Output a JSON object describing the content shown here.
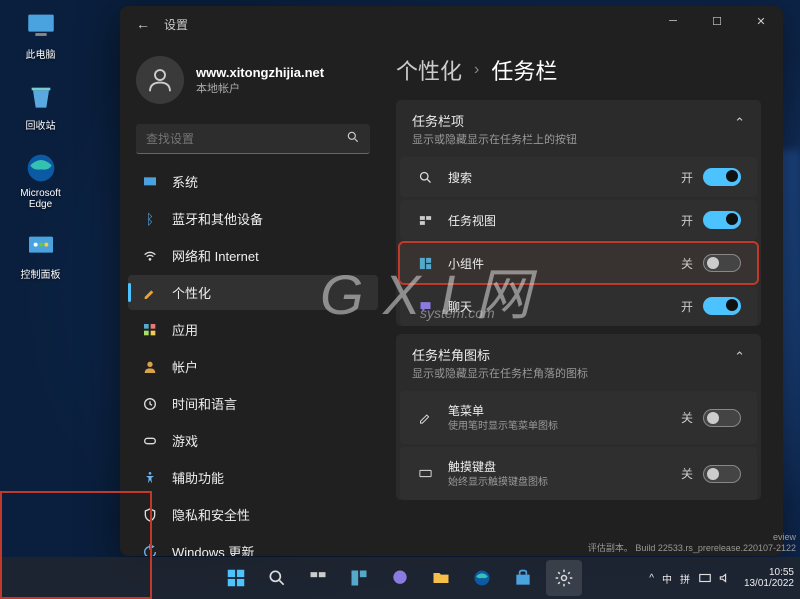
{
  "desktopIcons": [
    {
      "label": "此电脑",
      "icon": "pc"
    },
    {
      "label": "回收站",
      "icon": "trash"
    },
    {
      "label": "Microsoft Edge",
      "icon": "edge"
    },
    {
      "label": "控制面板",
      "icon": "control"
    }
  ],
  "window": {
    "title": "设置",
    "user": {
      "name": "www.xitongzhijia.net",
      "accountType": "本地帐户"
    },
    "search": {
      "placeholder": "查找设置"
    },
    "nav": [
      {
        "label": "系统",
        "icon": "system"
      },
      {
        "label": "蓝牙和其他设备",
        "icon": "bt"
      },
      {
        "label": "网络和 Internet",
        "icon": "wifi"
      },
      {
        "label": "个性化",
        "icon": "personalize",
        "active": true
      },
      {
        "label": "应用",
        "icon": "apps"
      },
      {
        "label": "帐户",
        "icon": "account"
      },
      {
        "label": "时间和语言",
        "icon": "time"
      },
      {
        "label": "游戏",
        "icon": "game"
      },
      {
        "label": "辅助功能",
        "icon": "access"
      },
      {
        "label": "隐私和安全性",
        "icon": "privacy"
      },
      {
        "label": "Windows 更新",
        "icon": "update"
      }
    ],
    "breadcrumb": {
      "parent": "个性化",
      "current": "任务栏"
    },
    "sections": [
      {
        "title": "任务栏项",
        "subtitle": "显示或隐藏显示在任务栏上的按钮",
        "rows": [
          {
            "icon": "search",
            "title": "搜索",
            "state": "开",
            "on": true
          },
          {
            "icon": "taskview",
            "title": "任务视图",
            "state": "开",
            "on": true
          },
          {
            "icon": "widgets",
            "title": "小组件",
            "state": "关",
            "on": false,
            "highlighted": true
          },
          {
            "icon": "chat",
            "title": "聊天",
            "state": "开",
            "on": true
          }
        ]
      },
      {
        "title": "任务栏角图标",
        "subtitle": "显示或隐藏显示在任务栏角落的图标",
        "rows": [
          {
            "icon": "pen",
            "title": "笔菜单",
            "sub": "使用笔时显示笔菜单图标",
            "state": "关",
            "on": false
          },
          {
            "icon": "keyboard",
            "title": "触摸键盘",
            "sub": "始终显示触摸键盘图标",
            "state": "关",
            "on": false
          }
        ]
      }
    ]
  },
  "taskbar": {
    "centerIcons": [
      "start",
      "search",
      "taskview",
      "widgets",
      "chat",
      "files",
      "edge",
      "store",
      "settings"
    ],
    "tray": {
      "ime1": "中",
      "ime2": "拼",
      "chevron": "^"
    },
    "clock": {
      "time": "10:55",
      "date": "13/01/2022"
    }
  },
  "buildInfo": {
    "line1": "eview",
    "line2": "评估副本。 Build 22533.rs_prerelease.220107-2122"
  },
  "watermark": {
    "main": "G X I 网",
    "sub": "system.com"
  }
}
